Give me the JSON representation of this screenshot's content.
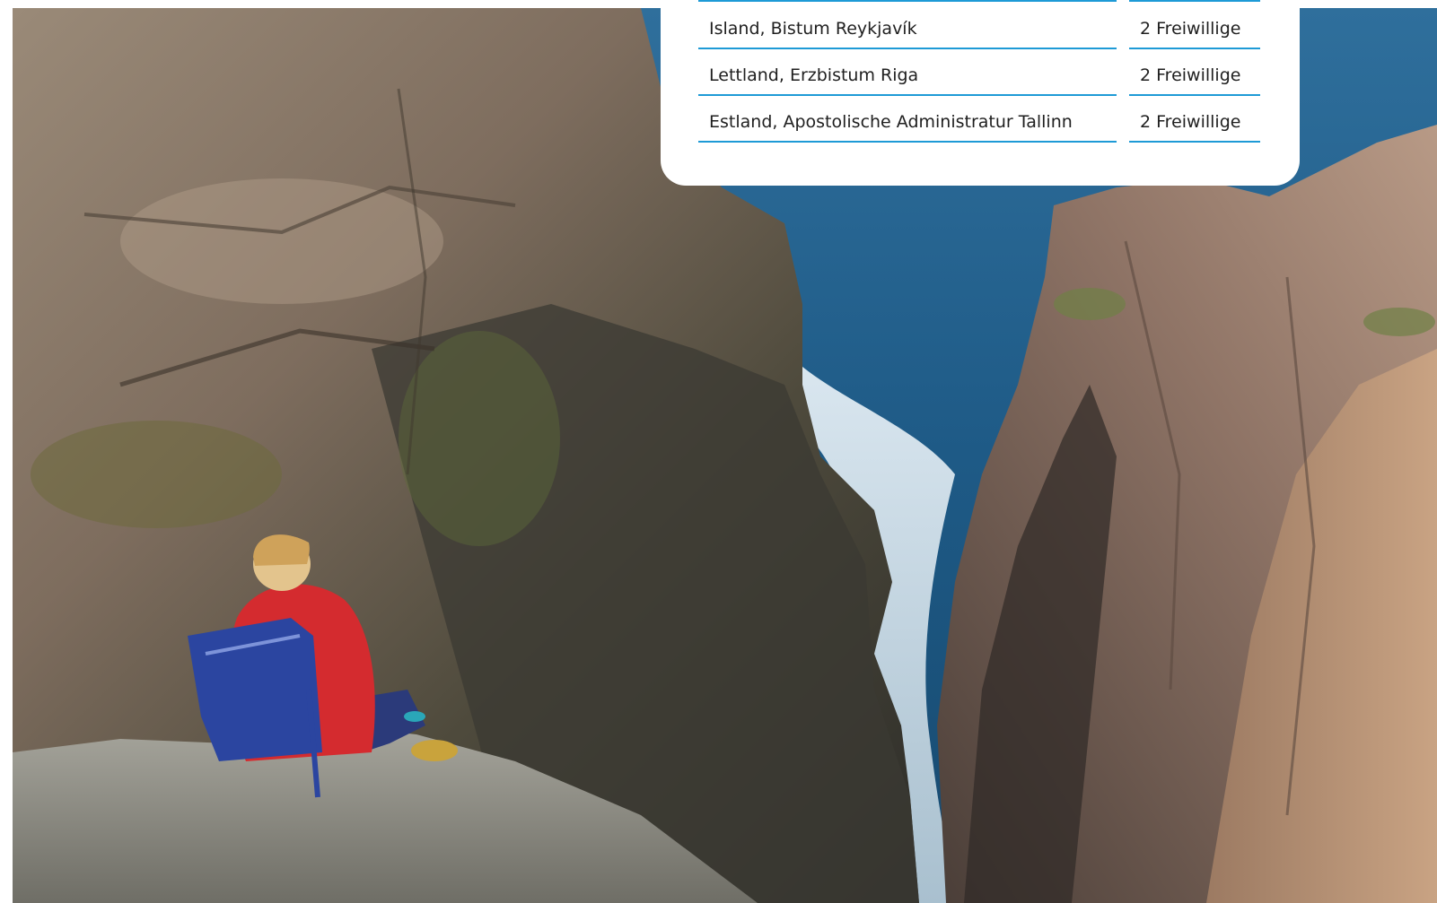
{
  "table": {
    "rows": [
      {
        "place": "Island, Bistum Reykjavík",
        "count": "2 Freiwillige"
      },
      {
        "place": "Lettland, Erzbistum Riga",
        "count": "2 Freiwillige"
      },
      {
        "place": "Estland, Apostolische Administratur Tallinn",
        "count": "2 Freiwillige"
      }
    ]
  },
  "colors": {
    "accent": "#1e9ad6",
    "card_background": "#ffffff"
  }
}
